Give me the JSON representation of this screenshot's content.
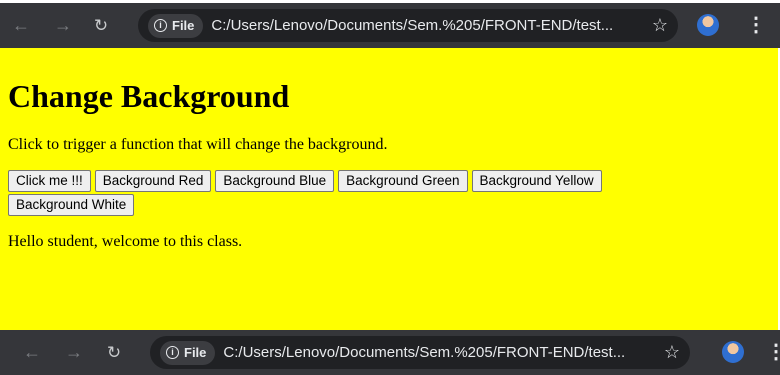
{
  "browser": {
    "chip_label": "File",
    "url": "C:/Users/Lenovo/Documents/Sem.%205/FRONT-END/test...",
    "icons": {
      "back": "back-arrow-icon",
      "forward": "forward-arrow-icon",
      "reload": "reload-icon",
      "info": "info-icon",
      "bookmark": "star-icon",
      "profile": "avatar",
      "menu": "kebab-menu-icon"
    }
  },
  "page": {
    "heading": "Change Background",
    "description": "Click to trigger a function that will change the background.",
    "buttons": [
      "Click me !!!",
      "Background Red",
      "Background Blue",
      "Background Green",
      "Background Yellow",
      "Background White"
    ],
    "greeting": "Hello student, welcome to this class.",
    "background_color": "#ffff00"
  },
  "colors": {
    "toolbar": "#35363a",
    "omnibox": "#202124",
    "page_background": "#ffff00"
  }
}
